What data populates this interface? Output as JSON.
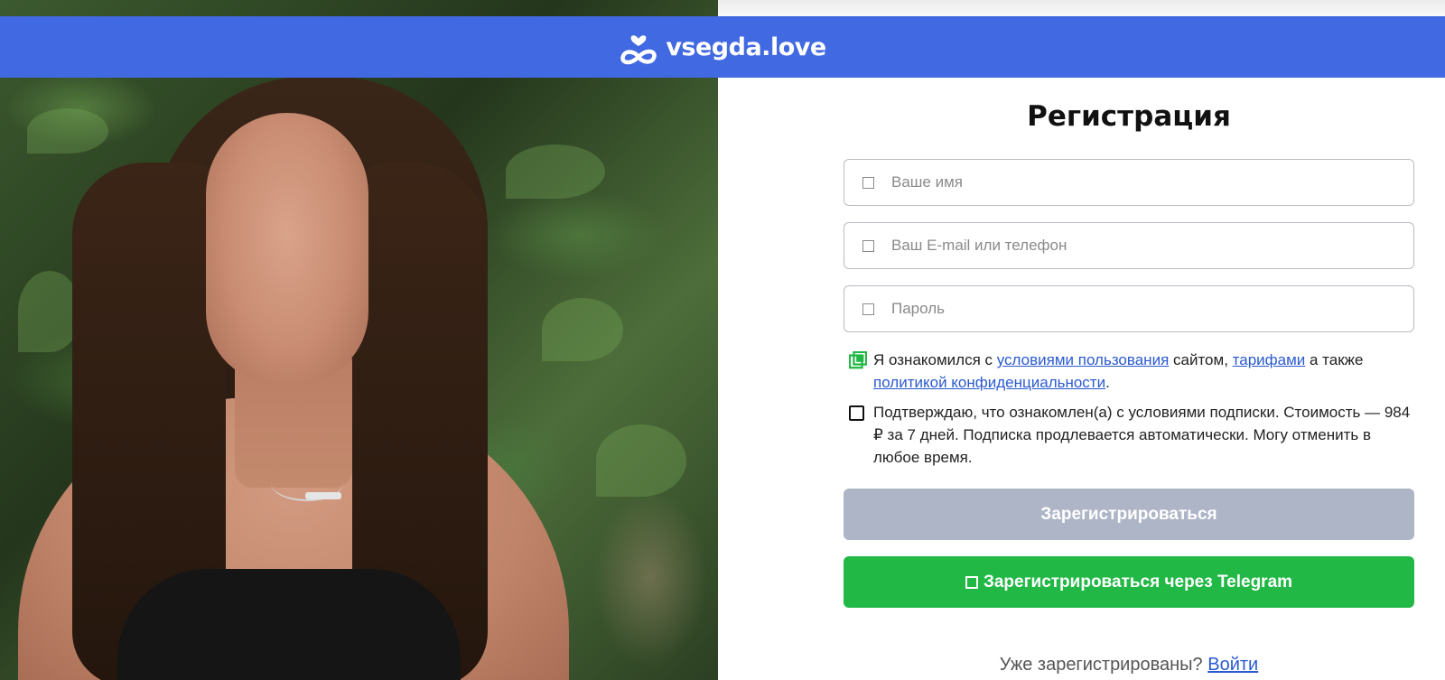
{
  "header": {
    "brand": "vsegda.love",
    "colors": {
      "bar": "#4169e1",
      "text": "#ffffff"
    }
  },
  "photo": {
    "description_icon": "profile-photo"
  },
  "form": {
    "title": "Регистрация",
    "fields": [
      {
        "name": "name",
        "placeholder": "Ваше имя",
        "value": ""
      },
      {
        "name": "contact",
        "placeholder": "Ваш E-mail или телефон",
        "value": ""
      },
      {
        "name": "password",
        "placeholder": "Пароль",
        "value": ""
      }
    ],
    "terms": {
      "checked": true,
      "prefix": "Я ознакомился с ",
      "link_terms": "условиями пользования",
      "middle1": " сайтом, ",
      "link_tariffs": "тарифами",
      "middle2": " а также ",
      "link_privacy": "политикой конфиденциальности",
      "suffix": "."
    },
    "subscription": {
      "checked": false,
      "text": "Подтверждаю, что ознакомлен(а) с условиями подписки. Стоимость — 984 ₽ за 7 дней. Подписка продлевается автоматически. Могу отменить в любое время."
    },
    "register_button": "Зарегистрироваться",
    "telegram_button": "Зарегистрироваться через Telegram",
    "already_text": "Уже зарегистрированы? ",
    "login_link": "Войти"
  },
  "colors": {
    "accent": "#4169e1",
    "link": "#2a5ad0",
    "disabled_button": "#adb5c7",
    "telegram_button": "#22b845",
    "checkbox_checked": "#22b845"
  }
}
